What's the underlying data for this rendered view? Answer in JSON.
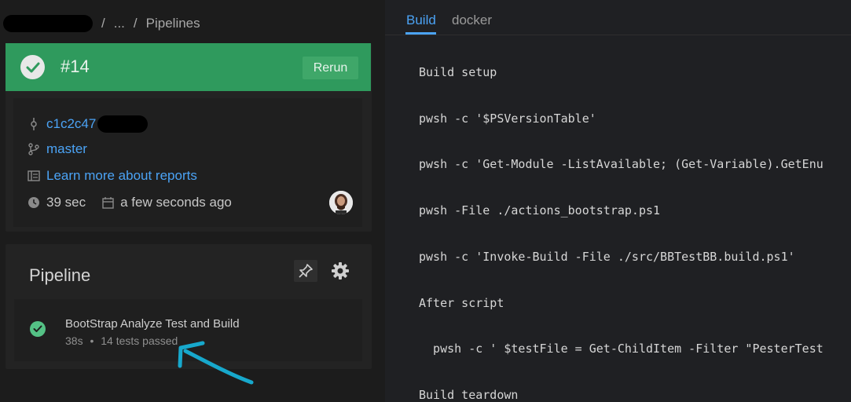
{
  "breadcrumb": {
    "separator": "/",
    "ellipsis": "...",
    "current": "Pipelines"
  },
  "build": {
    "number": "#14",
    "rerun_label": "Rerun",
    "status_color": "#2f9a5d",
    "commit": "c1c2c47",
    "branch": "master",
    "reports_link": "Learn more about reports",
    "duration": "39 sec",
    "started": "a few seconds ago"
  },
  "pipeline": {
    "title": "Pipeline",
    "steps": [
      {
        "name": "BootStrap Analyze Test and Build",
        "duration": "38s",
        "separator": "•",
        "tests": "14 tests passed"
      }
    ]
  },
  "log_panel": {
    "tabs": [
      {
        "label": "Build",
        "active": true
      },
      {
        "label": "docker",
        "active": false
      }
    ],
    "lines": [
      "Build setup",
      "pwsh -c '$PSVersionTable'",
      "pwsh -c 'Get-Module -ListAvailable; (Get-Variable).GetEnu",
      "pwsh -File ./actions_bootstrap.ps1",
      "pwsh -c 'Invoke-Build -File ./src/BBTestBB.build.ps1'",
      "After script",
      "  pwsh -c ' $testFile = Get-ChildItem -Filter \"PesterTest",
      "Build teardown"
    ]
  },
  "colors": {
    "accent": "#4ba3f5",
    "success": "#54c185",
    "annotation_arrow": "#17a8cc"
  }
}
